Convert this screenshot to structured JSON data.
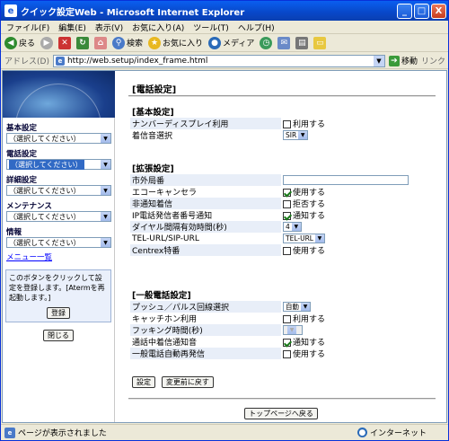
{
  "window": {
    "title": "クイック設定Web - Microsoft Internet Explorer",
    "min": "_",
    "max": "□",
    "close": "X"
  },
  "menubar": {
    "items": [
      "ファイル(F)",
      "編集(E)",
      "表示(V)",
      "お気に入り(A)",
      "ツール(T)",
      "ヘルプ(H)"
    ]
  },
  "toolbar": {
    "back": "戻る",
    "search": "検索",
    "favorites": "お気に入り",
    "media": "メディア"
  },
  "address": {
    "label": "アドレス(D)",
    "url": "http://web.setup/index_frame.html",
    "go": "移動",
    "links": "リンク"
  },
  "sidebar": {
    "sections": [
      {
        "label": "基本設定",
        "value": "（選択してください）",
        "selected": false
      },
      {
        "label": "電話設定",
        "value": "（選択してください）",
        "selected": true
      },
      {
        "label": "詳細設定",
        "value": "（選択してください）",
        "selected": false
      },
      {
        "label": "メンテナンス",
        "value": "（選択してください）",
        "selected": false
      },
      {
        "label": "情報",
        "value": "（選択してください）",
        "selected": false
      }
    ],
    "menu_link": "メニュー一覧",
    "note": "このボタンをクリックして設定を登録します。[Atermを再起動します。]",
    "register_button": "登録",
    "close_button": "閉じる"
  },
  "page": {
    "title": "[電話設定]",
    "basic": {
      "heading": "[基本設定]",
      "rows": [
        {
          "label": "ナンバーディスプレイ利用",
          "control": "checkbox",
          "checked": false,
          "text": "利用する"
        },
        {
          "label": "着信音選択",
          "control": "select",
          "value": "SIR"
        }
      ]
    },
    "extended": {
      "heading": "[拡張設定]",
      "rows": [
        {
          "label": "市外局番",
          "control": "text",
          "value": ""
        },
        {
          "label": "エコーキャンセラ",
          "control": "checkbox",
          "checked": true,
          "text": "使用する"
        },
        {
          "label": "非通知着信",
          "control": "checkbox",
          "checked": false,
          "text": "拒否する"
        },
        {
          "label": "IP電話発信者番号通知",
          "control": "checkbox",
          "checked": true,
          "text": "通知する"
        },
        {
          "label": "ダイヤル間隔有効時間(秒)",
          "control": "select",
          "value": "4"
        },
        {
          "label": "TEL-URL/SIP-URL",
          "control": "select",
          "value": "TEL-URL"
        },
        {
          "label": "Centrex特番",
          "control": "checkbox",
          "checked": false,
          "text": "使用する"
        }
      ]
    },
    "general": {
      "heading": "[一般電話設定]",
      "rows": [
        {
          "label": "プッシュ／パルス回線選択",
          "control": "select",
          "value": "自動"
        },
        {
          "label": "キャッチホン利用",
          "control": "checkbox",
          "checked": false,
          "text": "利用する"
        },
        {
          "label": "フッキング時間(秒)",
          "control": "select",
          "value": ""
        },
        {
          "label": "通話中着信通知音",
          "control": "checkbox",
          "checked": true,
          "text": "通知する"
        },
        {
          "label": "一般電話自動再発信",
          "control": "checkbox",
          "checked": false,
          "text": "使用する"
        }
      ]
    },
    "set_button": "設定",
    "revert_button": "変更前に戻す",
    "top_button": "トップページへ戻る"
  },
  "status": {
    "text": "ページが表示されました",
    "zone": "インターネット"
  }
}
